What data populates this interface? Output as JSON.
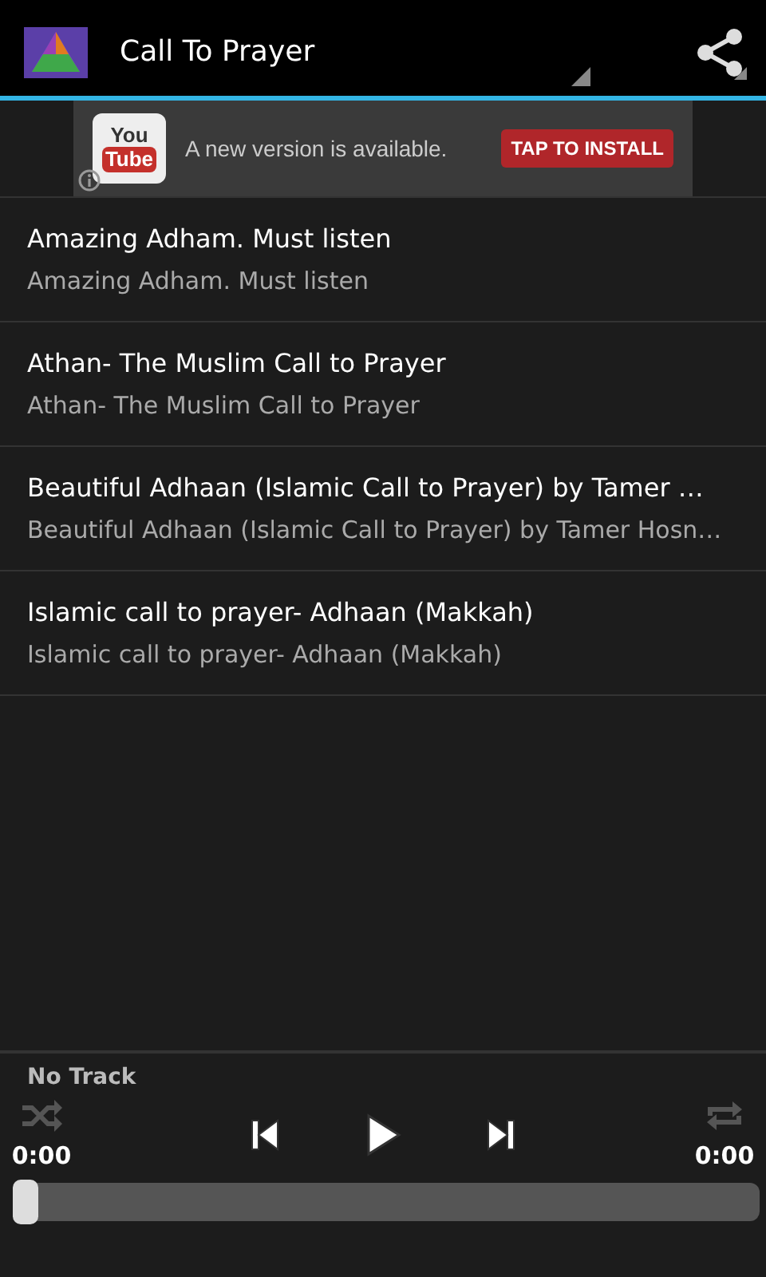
{
  "action_bar": {
    "title": "Call To Prayer"
  },
  "ad": {
    "logo_top": "You",
    "logo_bottom": "Tube",
    "message": "A new version is available.",
    "button": "TAP TO INSTALL"
  },
  "tracks": [
    {
      "title": "Amazing Adham. Must listen",
      "subtitle": "Amazing Adham. Must listen"
    },
    {
      "title": "Athan- The Muslim Call to Prayer",
      "subtitle": "Athan- The Muslim Call to Prayer"
    },
    {
      "title": "Beautiful Adhaan (Islamic Call to Prayer) by Tamer …",
      "subtitle": "Beautiful Adhaan (Islamic Call to Prayer) by Tamer Hosn…"
    },
    {
      "title": "Islamic call to prayer- Adhaan (Makkah)",
      "subtitle": "Islamic call to prayer- Adhaan (Makkah)"
    }
  ],
  "player": {
    "track": "No Track",
    "elapsed": "0:00",
    "duration": "0:00",
    "level": 0
  }
}
